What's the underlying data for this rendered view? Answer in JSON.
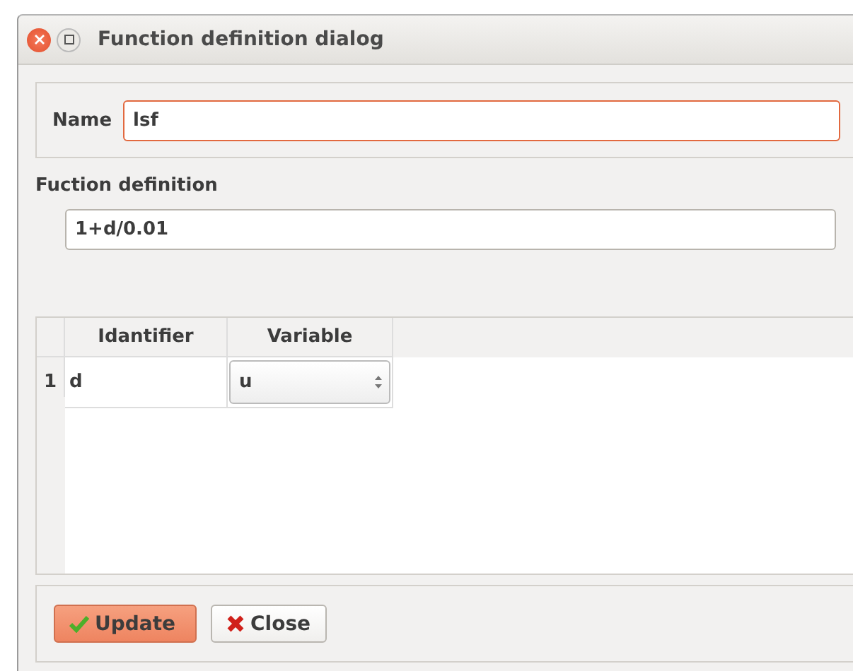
{
  "window": {
    "title": "Function definition dialog"
  },
  "name_field": {
    "label": "Name",
    "value": "lsf",
    "focused": true
  },
  "definition": {
    "label": "Fuction definition",
    "value": "1+d/0.01",
    "focused": false
  },
  "table": {
    "columns": [
      "Idantifier",
      "Variable"
    ],
    "rows": [
      {
        "number": "1",
        "identifier": "d",
        "variable": "u"
      }
    ]
  },
  "buttons": [
    {
      "label": "Update",
      "kind": "update",
      "highlighted": true
    },
    {
      "label": "Close",
      "kind": "close",
      "highlighted": false
    }
  ]
}
